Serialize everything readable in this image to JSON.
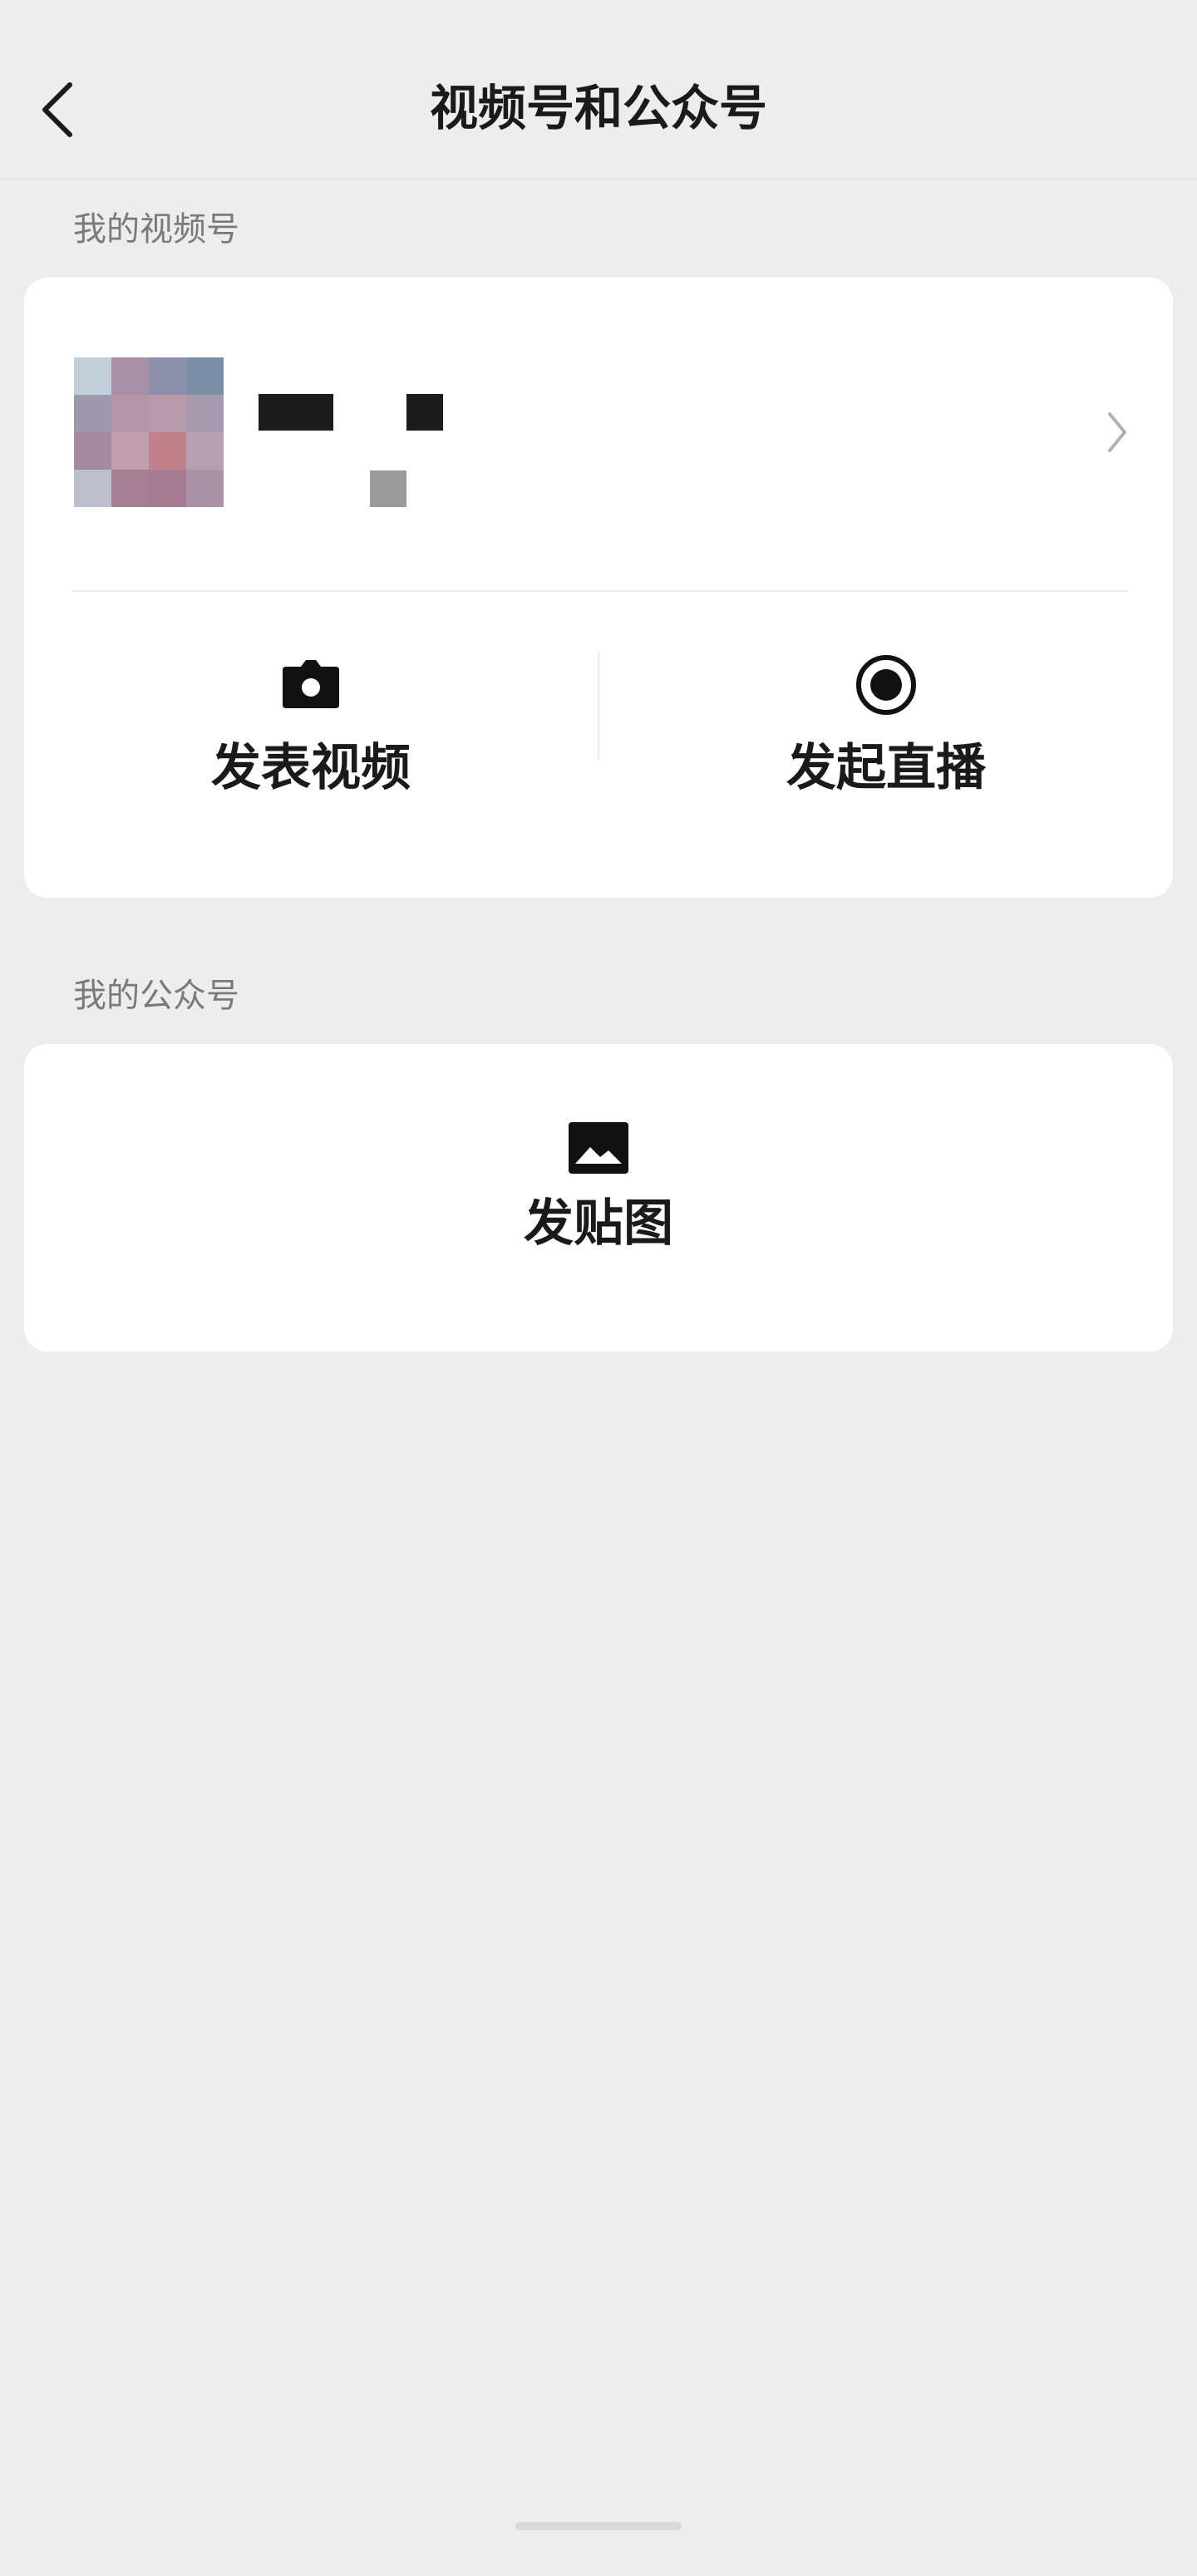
{
  "nav": {
    "title": "视频号和公众号",
    "back_icon": "chevron-left-icon"
  },
  "channels_section": {
    "label": "我的视频号",
    "profile": {
      "avatar": "avatar (pixelated)",
      "name": "",
      "subtitle": "",
      "chevron_icon": "chevron-right-icon"
    },
    "actions": [
      {
        "label": "发表视频",
        "icon": "camera-icon"
      },
      {
        "label": "发起直播",
        "icon": "live-record-icon"
      }
    ]
  },
  "official_section": {
    "label": "我的公众号",
    "actions": [
      {
        "label": "发贴图",
        "icon": "image-icon"
      }
    ]
  },
  "colors": {
    "background": "#ededed",
    "card": "#ffffff",
    "text_primary": "#1a1a1a",
    "text_secondary": "#7a7a7a"
  }
}
